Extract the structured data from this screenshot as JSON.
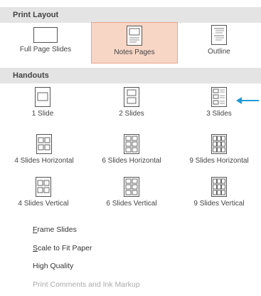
{
  "print_layout": {
    "header": "Print Layout",
    "options": [
      {
        "label": "Full Page Slides",
        "icon": "full-page-slide-icon",
        "selected": false
      },
      {
        "label": "Notes Pages",
        "icon": "notes-page-icon",
        "selected": true
      },
      {
        "label": "Outline",
        "icon": "outline-icon",
        "selected": false
      }
    ]
  },
  "handouts": {
    "header": "Handouts",
    "options": [
      {
        "label": "1 Slide"
      },
      {
        "label": "2 Slides"
      },
      {
        "label": "3 Slides"
      },
      {
        "label": "4 Slides Horizontal"
      },
      {
        "label": "6 Slides Horizontal"
      },
      {
        "label": "9 Slides Horizontal"
      },
      {
        "label": "4 Slides Vertical"
      },
      {
        "label": "6 Slides Vertical"
      },
      {
        "label": "9 Slides Vertical"
      }
    ]
  },
  "commands": [
    {
      "mnemonic": "F",
      "rest": "rame Slides",
      "enabled": true
    },
    {
      "mnemonic": "S",
      "rest": "cale to Fit Paper",
      "enabled": true
    },
    {
      "mnemonic": "",
      "rest": "High Quality",
      "enabled": true
    },
    {
      "mnemonic": "",
      "rest": "Print Comments and Ink Markup",
      "enabled": false
    }
  ],
  "colors": {
    "selected_fill": "#f7d6c6",
    "selected_border": "#e7a58a",
    "header_bg": "#e4e4e4",
    "arrow": "#1e9bd7"
  }
}
